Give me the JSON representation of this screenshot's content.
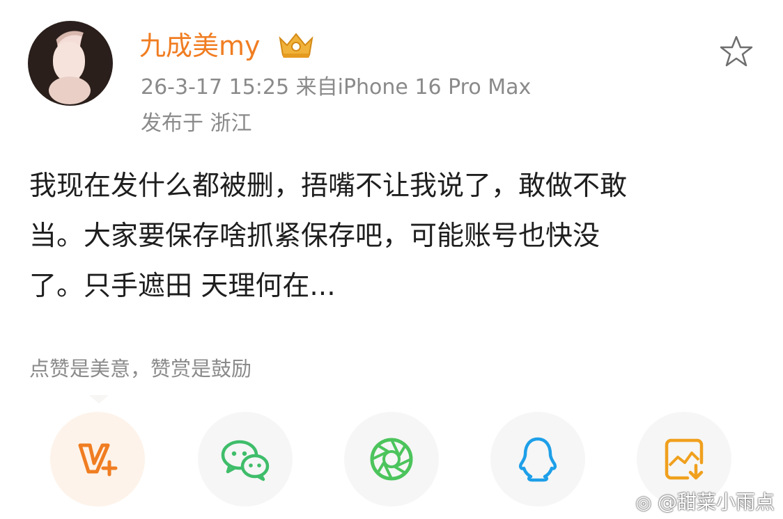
{
  "post": {
    "author": "九成美my",
    "timestamp_source": "26-3-17 15:25  来自iPhone 16 Pro Max",
    "location": "发布于 浙江",
    "text_lines": [
      "我现在发什么都被删，捂嘴不让我说了，敢做不敢",
      "当。大家要保存啥抓紧保存吧，可能账号也快没",
      "了。只手遮田 天理何在..."
    ]
  },
  "reward": {
    "note": "点赞是美意，赞赏是鼓励"
  },
  "share_icons": [
    "vplus-icon",
    "wechat-icon",
    "moments-icon",
    "qq-icon",
    "save-image-icon"
  ],
  "watermark": {
    "text": "@甜菜小雨点"
  },
  "colors": {
    "accent": "#f07d22",
    "meta": "#8a8a8a",
    "wechat": "#3fbd6a",
    "moments": "#4cc45c",
    "qq": "#1e9fe8"
  }
}
